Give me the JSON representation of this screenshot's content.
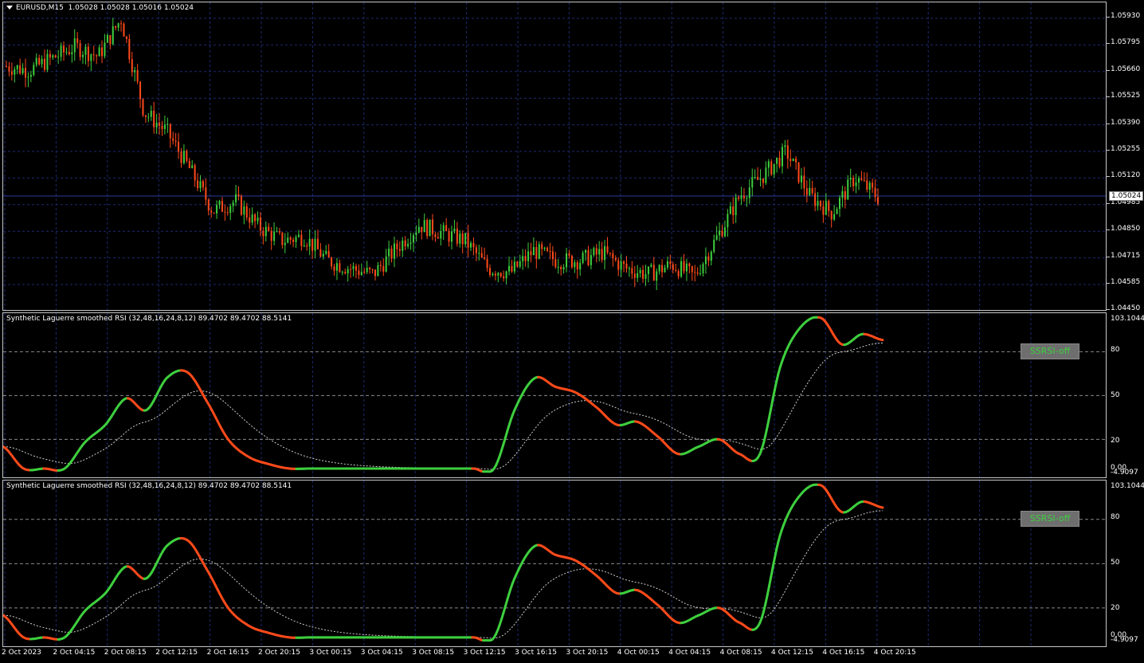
{
  "main": {
    "symbol": "EURUSD,M15",
    "ohlc": "1.05028 1.05028 1.05016 1.05024",
    "current_price": "1.05024",
    "price_labels": [
      "1.05930",
      "1.05795",
      "1.05660",
      "1.05525",
      "1.05390",
      "1.05255",
      "1.05120",
      "1.04985",
      "1.04850",
      "1.04715",
      "1.04585",
      "1.04450"
    ]
  },
  "ind1": {
    "title": "Synthetic Laguerre smoothed RSI (32,48,16,24,8,12) 89.4702 89.4702 88.5141",
    "levels": [
      "103.1044",
      "80",
      "50",
      "20",
      "0.00",
      "-4.9097"
    ],
    "button": "SSRSI-off"
  },
  "ind2": {
    "title": "Synthetic Laguerre smoothed RSI (32,48,16,24,8,12) 89.4702 89.4702 88.5141",
    "levels": [
      "103.1044",
      "80",
      "50",
      "20",
      "0.00",
      "-4.9097"
    ],
    "button": "SSRSI-off"
  },
  "time_labels": [
    "2 Oct 2023",
    "2 Oct 04:15",
    "2 Oct 08:15",
    "2 Oct 12:15",
    "2 Oct 16:15",
    "2 Oct 20:15",
    "3 Oct 00:15",
    "3 Oct 04:15",
    "3 Oct 08:15",
    "3 Oct 12:15",
    "3 Oct 16:15",
    "3 Oct 20:15",
    "4 Oct 00:15",
    "4 Oct 04:15",
    "4 Oct 08:15",
    "4 Oct 12:15",
    "4 Oct 16:15",
    "4 Oct 20:15"
  ],
  "colors": {
    "up": "#3ecf3e",
    "down": "#ff4a1a",
    "grid": "#1c2a6e",
    "signal": "#cfcfcf"
  },
  "chart_data": [
    {
      "type": "candlestick-line",
      "series": [
        {
          "values": [
            1.0568,
            1.0566,
            1.0572,
            1.0578,
            1.0573,
            1.0592,
            1.0545,
            1.0535,
            1.0516,
            1.0495,
            1.05,
            1.0487,
            1.048,
            1.0482,
            1.047,
            1.0466,
            1.0463,
            1.0476,
            1.0488,
            1.0484,
            1.048,
            1.0466,
            1.0464,
            1.0475,
            1.047,
            1.047,
            1.0474,
            1.0466,
            1.0463,
            1.0468,
            1.0462,
            1.0482,
            1.0503,
            1.0513,
            1.0525,
            1.0503,
            1.0494,
            1.0512,
            1.0502
          ]
        }
      ],
      "ylim": [
        1.0445,
        1.0593
      ]
    },
    {
      "type": "line",
      "series": [
        {
          "values": [
            15,
            0,
            0,
            0,
            18,
            30,
            48,
            40,
            62,
            66,
            45,
            20,
            8,
            3,
            0,
            0,
            0,
            0,
            0,
            0,
            0,
            0,
            0,
            0,
            0,
            40,
            62,
            56,
            52,
            42,
            30,
            32,
            22,
            10,
            15,
            20,
            10,
            10,
            70,
            97,
            103,
            85,
            92,
            88
          ]
        }
      ],
      "ylim": [
        -4.9097,
        103.1044
      ]
    },
    {
      "type": "line",
      "series": [
        {
          "values": [
            15,
            0,
            0,
            0,
            18,
            30,
            48,
            40,
            62,
            66,
            45,
            20,
            8,
            3,
            0,
            0,
            0,
            0,
            0,
            0,
            0,
            0,
            0,
            0,
            0,
            40,
            62,
            56,
            52,
            42,
            30,
            32,
            22,
            10,
            15,
            20,
            10,
            10,
            70,
            97,
            103,
            85,
            92,
            88
          ]
        }
      ],
      "ylim": [
        -4.9097,
        103.1044
      ]
    }
  ]
}
